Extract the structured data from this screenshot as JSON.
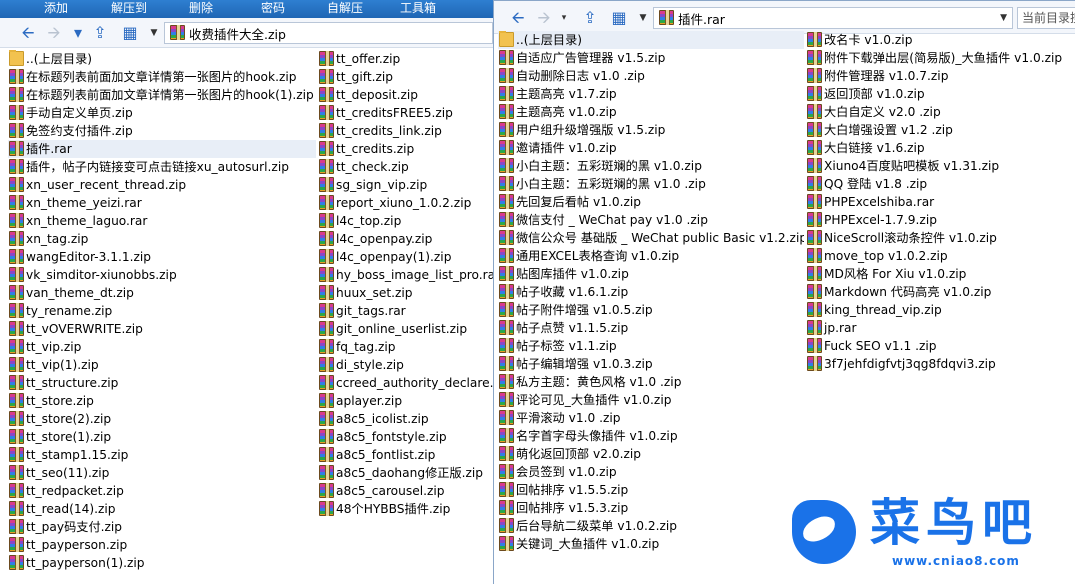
{
  "menu": [
    "添加",
    "解压到",
    "删除",
    "密码",
    "自解压",
    "工具箱"
  ],
  "left_window": {
    "address": "收费插件大全.zip",
    "col1": [
      {
        "name": "..(上层目录)",
        "type": "folder"
      },
      {
        "name": "在标题列表前面加文章详情第一张图片的hook.zip",
        "type": "archive"
      },
      {
        "name": "在标题列表前面加文章详情第一张图片的hook(1).zip",
        "type": "archive"
      },
      {
        "name": "手动自定义单页.zip",
        "type": "archive"
      },
      {
        "name": "免签约支付插件.zip",
        "type": "archive"
      },
      {
        "name": "插件.rar",
        "type": "archive",
        "selected": true
      },
      {
        "name": "插件，帖子内链接变可点击链接xu_autosurl.zip",
        "type": "archive"
      },
      {
        "name": "xn_user_recent_thread.zip",
        "type": "archive"
      },
      {
        "name": "xn_theme_yeizi.rar",
        "type": "archive"
      },
      {
        "name": "xn_theme_laguo.rar",
        "type": "archive"
      },
      {
        "name": "xn_tag.zip",
        "type": "archive"
      },
      {
        "name": "wangEditor-3.1.1.zip",
        "type": "archive"
      },
      {
        "name": "vk_simditor-xiunobbs.zip",
        "type": "archive"
      },
      {
        "name": "van_theme_dt.zip",
        "type": "archive"
      },
      {
        "name": "ty_rename.zip",
        "type": "archive"
      },
      {
        "name": "tt_vOVERWRITE.zip",
        "type": "archive"
      },
      {
        "name": "tt_vip.zip",
        "type": "archive"
      },
      {
        "name": "tt_vip(1).zip",
        "type": "archive"
      },
      {
        "name": "tt_structure.zip",
        "type": "archive"
      },
      {
        "name": "tt_store.zip",
        "type": "archive"
      },
      {
        "name": "tt_store(2).zip",
        "type": "archive"
      },
      {
        "name": "tt_store(1).zip",
        "type": "archive"
      },
      {
        "name": "tt_stamp1.15.zip",
        "type": "archive"
      },
      {
        "name": "tt_seo(11).zip",
        "type": "archive"
      },
      {
        "name": "tt_redpacket.zip",
        "type": "archive"
      },
      {
        "name": "tt_read(14).zip",
        "type": "archive"
      },
      {
        "name": "tt_pay码支付.zip",
        "type": "archive"
      },
      {
        "name": "tt_payperson.zip",
        "type": "archive"
      },
      {
        "name": "tt_payperson(1).zip",
        "type": "archive"
      }
    ],
    "col2": [
      {
        "name": "tt_offer.zip",
        "type": "archive"
      },
      {
        "name": "tt_gift.zip",
        "type": "archive"
      },
      {
        "name": "tt_deposit.zip",
        "type": "archive"
      },
      {
        "name": "tt_creditsFREE5.zip",
        "type": "archive"
      },
      {
        "name": "tt_credits_link.zip",
        "type": "archive"
      },
      {
        "name": "tt_credits.zip",
        "type": "archive"
      },
      {
        "name": "tt_check.zip",
        "type": "archive"
      },
      {
        "name": "sg_sign_vip.zip",
        "type": "archive"
      },
      {
        "name": "report_xiuno_1.0.2.zip",
        "type": "archive"
      },
      {
        "name": "l4c_top.zip",
        "type": "archive"
      },
      {
        "name": "l4c_openpay.zip",
        "type": "archive"
      },
      {
        "name": "l4c_openpay(1).zip",
        "type": "archive"
      },
      {
        "name": "hy_boss_image_list_pro.rar",
        "type": "archive"
      },
      {
        "name": "huux_set.zip",
        "type": "archive"
      },
      {
        "name": "git_tags.rar",
        "type": "archive"
      },
      {
        "name": "git_online_userlist.zip",
        "type": "archive"
      },
      {
        "name": "fq_tag.zip",
        "type": "archive"
      },
      {
        "name": "di_style.zip",
        "type": "archive"
      },
      {
        "name": "ccreed_authority_declare.zi",
        "type": "archive"
      },
      {
        "name": "aplayer.zip",
        "type": "archive"
      },
      {
        "name": "a8c5_icolist.zip",
        "type": "archive"
      },
      {
        "name": "a8c5_fontstyle.zip",
        "type": "archive"
      },
      {
        "name": "a8c5_fontlist.zip",
        "type": "archive"
      },
      {
        "name": "a8c5_daohang修正版.zip",
        "type": "archive"
      },
      {
        "name": "a8c5_carousel.zip",
        "type": "archive"
      },
      {
        "name": "48个HYBBS插件.zip",
        "type": "archive"
      }
    ]
  },
  "right_window": {
    "address": "插件.rar",
    "search_placeholder": "当前目录搜",
    "col1": [
      {
        "name": "..(上层目录)",
        "type": "folder",
        "selected": true
      },
      {
        "name": "自适应广告管理器 v1.5.zip",
        "type": "archive"
      },
      {
        "name": "自动删除日志 v1.0 .zip",
        "type": "archive"
      },
      {
        "name": "主题高亮 v1.7.zip",
        "type": "archive"
      },
      {
        "name": "主题高亮 v1.0.zip",
        "type": "archive"
      },
      {
        "name": "用户组升级增强版 v1.5.zip",
        "type": "archive"
      },
      {
        "name": "邀请插件 v1.0.zip",
        "type": "archive"
      },
      {
        "name": "小白主题：五彩斑斓的黑 v1.0.zip",
        "type": "archive"
      },
      {
        "name": "小白主题：五彩斑斓的黑 v1.0 .zip",
        "type": "archive"
      },
      {
        "name": "先回复后看帖 v1.0.zip",
        "type": "archive"
      },
      {
        "name": "微信支付 _ WeChat pay v1.0 .zip",
        "type": "archive"
      },
      {
        "name": "微信公众号 基础版 _ WeChat public Basic v1.2.zip",
        "type": "archive"
      },
      {
        "name": "通用EXCEL表格查询 v1.0.zip",
        "type": "archive"
      },
      {
        "name": "贴图库插件 v1.0.zip",
        "type": "archive"
      },
      {
        "name": "帖子收藏 v1.6.1.zip",
        "type": "archive"
      },
      {
        "name": "帖子附件增强 v1.0.5.zip",
        "type": "archive"
      },
      {
        "name": "帖子点赞 v1.1.5.zip",
        "type": "archive"
      },
      {
        "name": "帖子标签 v1.1.zip",
        "type": "archive"
      },
      {
        "name": "帖子编辑增强 v1.0.3.zip",
        "type": "archive"
      },
      {
        "name": "私方主题：黄色风格 v1.0 .zip",
        "type": "archive"
      },
      {
        "name": "评论可见_大鱼插件 v1.0.zip",
        "type": "archive"
      },
      {
        "name": "平滑滚动 v1.0 .zip",
        "type": "archive"
      },
      {
        "name": "名字首字母头像插件 v1.0.zip",
        "type": "archive"
      },
      {
        "name": "萌化返回顶部 v2.0.zip",
        "type": "archive"
      },
      {
        "name": "会员签到 v1.0.zip",
        "type": "archive"
      },
      {
        "name": "回帖排序 v1.5.5.zip",
        "type": "archive"
      },
      {
        "name": "回帖排序 v1.5.3.zip",
        "type": "archive"
      },
      {
        "name": "后台导航二级菜单 v1.0.2.zip",
        "type": "archive"
      },
      {
        "name": "关键词_大鱼插件 v1.0.zip",
        "type": "archive"
      }
    ],
    "col2": [
      {
        "name": "改名卡 v1.0.zip",
        "type": "archive"
      },
      {
        "name": "附件下载弹出层(简易版)_大鱼插件 v1.0.zip",
        "type": "archive"
      },
      {
        "name": "附件管理器 v1.0.7.zip",
        "type": "archive"
      },
      {
        "name": "返回顶部 v1.0.zip",
        "type": "archive"
      },
      {
        "name": "大白自定义 v2.0 .zip",
        "type": "archive"
      },
      {
        "name": "大白增强设置 v1.2 .zip",
        "type": "archive"
      },
      {
        "name": "大白链接 v1.6.zip",
        "type": "archive"
      },
      {
        "name": "Xiuno4百度贴吧模板 v1.31.zip",
        "type": "archive"
      },
      {
        "name": "QQ 登陆 v1.8 .zip",
        "type": "archive"
      },
      {
        "name": "PHPExcelshiba.rar",
        "type": "archive"
      },
      {
        "name": "PHPExcel-1.7.9.zip",
        "type": "archive"
      },
      {
        "name": "NiceScroll滚动条控件 v1.0.zip",
        "type": "archive"
      },
      {
        "name": "move_top v1.0.2.zip",
        "type": "archive"
      },
      {
        "name": "MD风格 For Xiu v1.0.zip",
        "type": "archive"
      },
      {
        "name": "Markdown 代码高亮 v1.0.zip",
        "type": "archive"
      },
      {
        "name": "king_thread_vip.zip",
        "type": "archive"
      },
      {
        "name": "jp.rar",
        "type": "archive"
      },
      {
        "name": "Fuck SEO v1.1 .zip",
        "type": "archive"
      },
      {
        "name": "3f7jehfdigfvtj3qg8fdqvi3.zip",
        "type": "archive"
      }
    ]
  },
  "watermark": {
    "name": "菜鸟吧",
    "url": "www.cniao8.com"
  },
  "colors": {
    "menu_bg": "#1f66b4",
    "accent": "#1a72e8",
    "selection": "#e8eef7"
  }
}
